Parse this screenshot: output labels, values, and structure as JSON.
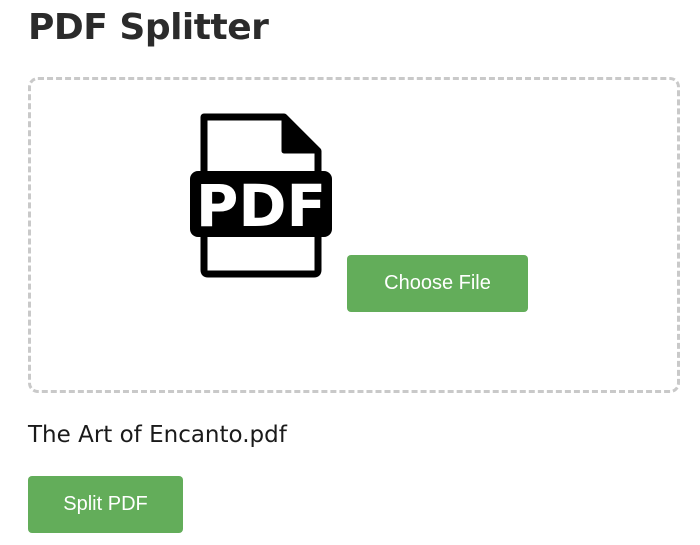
{
  "page": {
    "title": "PDF Splitter"
  },
  "dropzone": {
    "icon": "pdf-file-icon",
    "icon_text": "PDF",
    "choose_button_label": "Choose File"
  },
  "selected_file": {
    "name": "The Art of Encanto.pdf"
  },
  "actions": {
    "split_button_label": "Split PDF"
  },
  "colors": {
    "button_background": "#63ad5a",
    "button_text": "#ffffff",
    "dropzone_border": "#c9c9c9",
    "title_text": "#2b2b2b"
  }
}
